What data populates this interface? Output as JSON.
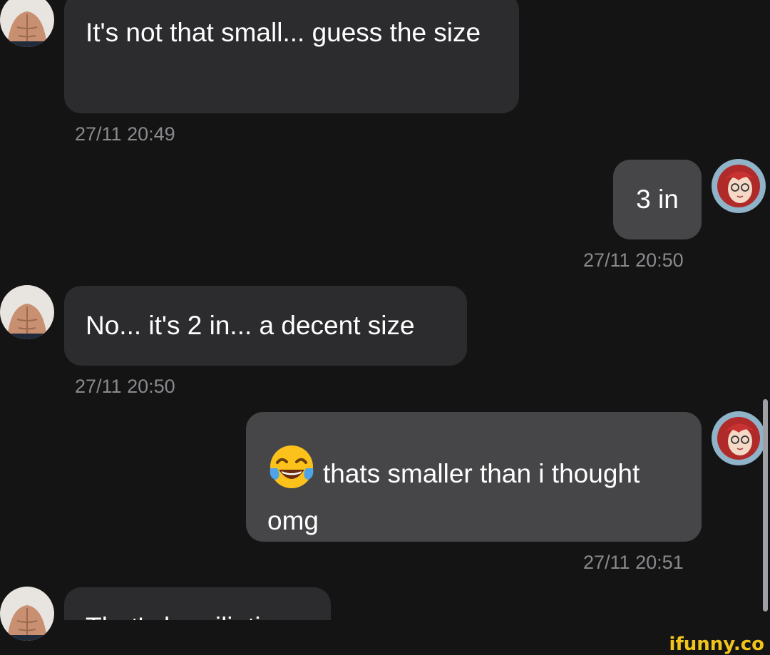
{
  "conversation": {
    "messages": [
      {
        "text": "It's not that small... guess the size",
        "time": "27/11 20:49",
        "direction": "incoming"
      },
      {
        "text": "3 in",
        "time": "27/11 20:50",
        "direction": "outgoing"
      },
      {
        "text": "No... it's 2 in... a decent size",
        "time": "27/11 20:50",
        "direction": "incoming"
      },
      {
        "emoji": "face-with-tears-of-joy",
        "text": "thats smaller than i thought omg",
        "time": "27/11 20:51",
        "direction": "outgoing"
      },
      {
        "text": "That's humiliating",
        "direction": "incoming"
      }
    ]
  },
  "avatars": {
    "incoming": "shirtless-torso-avatar",
    "outgoing": "red-haired-anime-girl-avatar"
  },
  "colors": {
    "background": "#141414",
    "incoming_bubble": "#2c2c2e",
    "outgoing_bubble": "#464648",
    "timestamp": "#8a8a8e",
    "watermark": "#f0c419"
  },
  "watermark": {
    "text": "ifunny.co"
  }
}
